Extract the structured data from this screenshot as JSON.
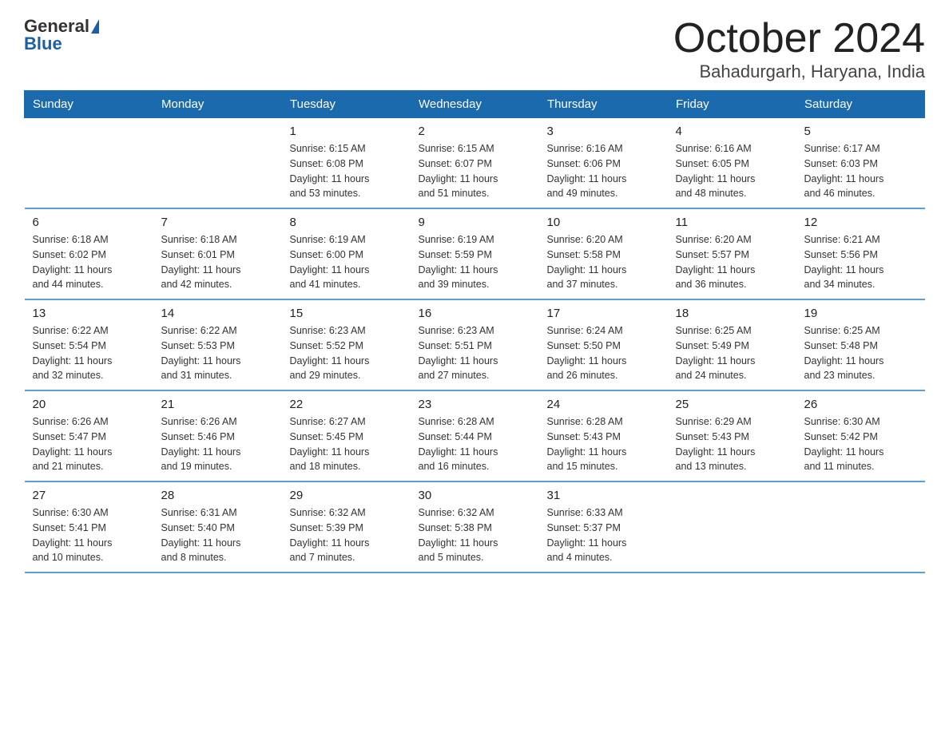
{
  "header": {
    "logo": {
      "general": "General",
      "blue": "Blue"
    },
    "title": "October 2024",
    "location": "Bahadurgarh, Haryana, India"
  },
  "calendar": {
    "days": [
      "Sunday",
      "Monday",
      "Tuesday",
      "Wednesday",
      "Thursday",
      "Friday",
      "Saturday"
    ],
    "weeks": [
      [
        {
          "day": "",
          "detail": ""
        },
        {
          "day": "",
          "detail": ""
        },
        {
          "day": "1",
          "detail": "Sunrise: 6:15 AM\nSunset: 6:08 PM\nDaylight: 11 hours\nand 53 minutes."
        },
        {
          "day": "2",
          "detail": "Sunrise: 6:15 AM\nSunset: 6:07 PM\nDaylight: 11 hours\nand 51 minutes."
        },
        {
          "day": "3",
          "detail": "Sunrise: 6:16 AM\nSunset: 6:06 PM\nDaylight: 11 hours\nand 49 minutes."
        },
        {
          "day": "4",
          "detail": "Sunrise: 6:16 AM\nSunset: 6:05 PM\nDaylight: 11 hours\nand 48 minutes."
        },
        {
          "day": "5",
          "detail": "Sunrise: 6:17 AM\nSunset: 6:03 PM\nDaylight: 11 hours\nand 46 minutes."
        }
      ],
      [
        {
          "day": "6",
          "detail": "Sunrise: 6:18 AM\nSunset: 6:02 PM\nDaylight: 11 hours\nand 44 minutes."
        },
        {
          "day": "7",
          "detail": "Sunrise: 6:18 AM\nSunset: 6:01 PM\nDaylight: 11 hours\nand 42 minutes."
        },
        {
          "day": "8",
          "detail": "Sunrise: 6:19 AM\nSunset: 6:00 PM\nDaylight: 11 hours\nand 41 minutes."
        },
        {
          "day": "9",
          "detail": "Sunrise: 6:19 AM\nSunset: 5:59 PM\nDaylight: 11 hours\nand 39 minutes."
        },
        {
          "day": "10",
          "detail": "Sunrise: 6:20 AM\nSunset: 5:58 PM\nDaylight: 11 hours\nand 37 minutes."
        },
        {
          "day": "11",
          "detail": "Sunrise: 6:20 AM\nSunset: 5:57 PM\nDaylight: 11 hours\nand 36 minutes."
        },
        {
          "day": "12",
          "detail": "Sunrise: 6:21 AM\nSunset: 5:56 PM\nDaylight: 11 hours\nand 34 minutes."
        }
      ],
      [
        {
          "day": "13",
          "detail": "Sunrise: 6:22 AM\nSunset: 5:54 PM\nDaylight: 11 hours\nand 32 minutes."
        },
        {
          "day": "14",
          "detail": "Sunrise: 6:22 AM\nSunset: 5:53 PM\nDaylight: 11 hours\nand 31 minutes."
        },
        {
          "day": "15",
          "detail": "Sunrise: 6:23 AM\nSunset: 5:52 PM\nDaylight: 11 hours\nand 29 minutes."
        },
        {
          "day": "16",
          "detail": "Sunrise: 6:23 AM\nSunset: 5:51 PM\nDaylight: 11 hours\nand 27 minutes."
        },
        {
          "day": "17",
          "detail": "Sunrise: 6:24 AM\nSunset: 5:50 PM\nDaylight: 11 hours\nand 26 minutes."
        },
        {
          "day": "18",
          "detail": "Sunrise: 6:25 AM\nSunset: 5:49 PM\nDaylight: 11 hours\nand 24 minutes."
        },
        {
          "day": "19",
          "detail": "Sunrise: 6:25 AM\nSunset: 5:48 PM\nDaylight: 11 hours\nand 23 minutes."
        }
      ],
      [
        {
          "day": "20",
          "detail": "Sunrise: 6:26 AM\nSunset: 5:47 PM\nDaylight: 11 hours\nand 21 minutes."
        },
        {
          "day": "21",
          "detail": "Sunrise: 6:26 AM\nSunset: 5:46 PM\nDaylight: 11 hours\nand 19 minutes."
        },
        {
          "day": "22",
          "detail": "Sunrise: 6:27 AM\nSunset: 5:45 PM\nDaylight: 11 hours\nand 18 minutes."
        },
        {
          "day": "23",
          "detail": "Sunrise: 6:28 AM\nSunset: 5:44 PM\nDaylight: 11 hours\nand 16 minutes."
        },
        {
          "day": "24",
          "detail": "Sunrise: 6:28 AM\nSunset: 5:43 PM\nDaylight: 11 hours\nand 15 minutes."
        },
        {
          "day": "25",
          "detail": "Sunrise: 6:29 AM\nSunset: 5:43 PM\nDaylight: 11 hours\nand 13 minutes."
        },
        {
          "day": "26",
          "detail": "Sunrise: 6:30 AM\nSunset: 5:42 PM\nDaylight: 11 hours\nand 11 minutes."
        }
      ],
      [
        {
          "day": "27",
          "detail": "Sunrise: 6:30 AM\nSunset: 5:41 PM\nDaylight: 11 hours\nand 10 minutes."
        },
        {
          "day": "28",
          "detail": "Sunrise: 6:31 AM\nSunset: 5:40 PM\nDaylight: 11 hours\nand 8 minutes."
        },
        {
          "day": "29",
          "detail": "Sunrise: 6:32 AM\nSunset: 5:39 PM\nDaylight: 11 hours\nand 7 minutes."
        },
        {
          "day": "30",
          "detail": "Sunrise: 6:32 AM\nSunset: 5:38 PM\nDaylight: 11 hours\nand 5 minutes."
        },
        {
          "day": "31",
          "detail": "Sunrise: 6:33 AM\nSunset: 5:37 PM\nDaylight: 11 hours\nand 4 minutes."
        },
        {
          "day": "",
          "detail": ""
        },
        {
          "day": "",
          "detail": ""
        }
      ]
    ]
  }
}
